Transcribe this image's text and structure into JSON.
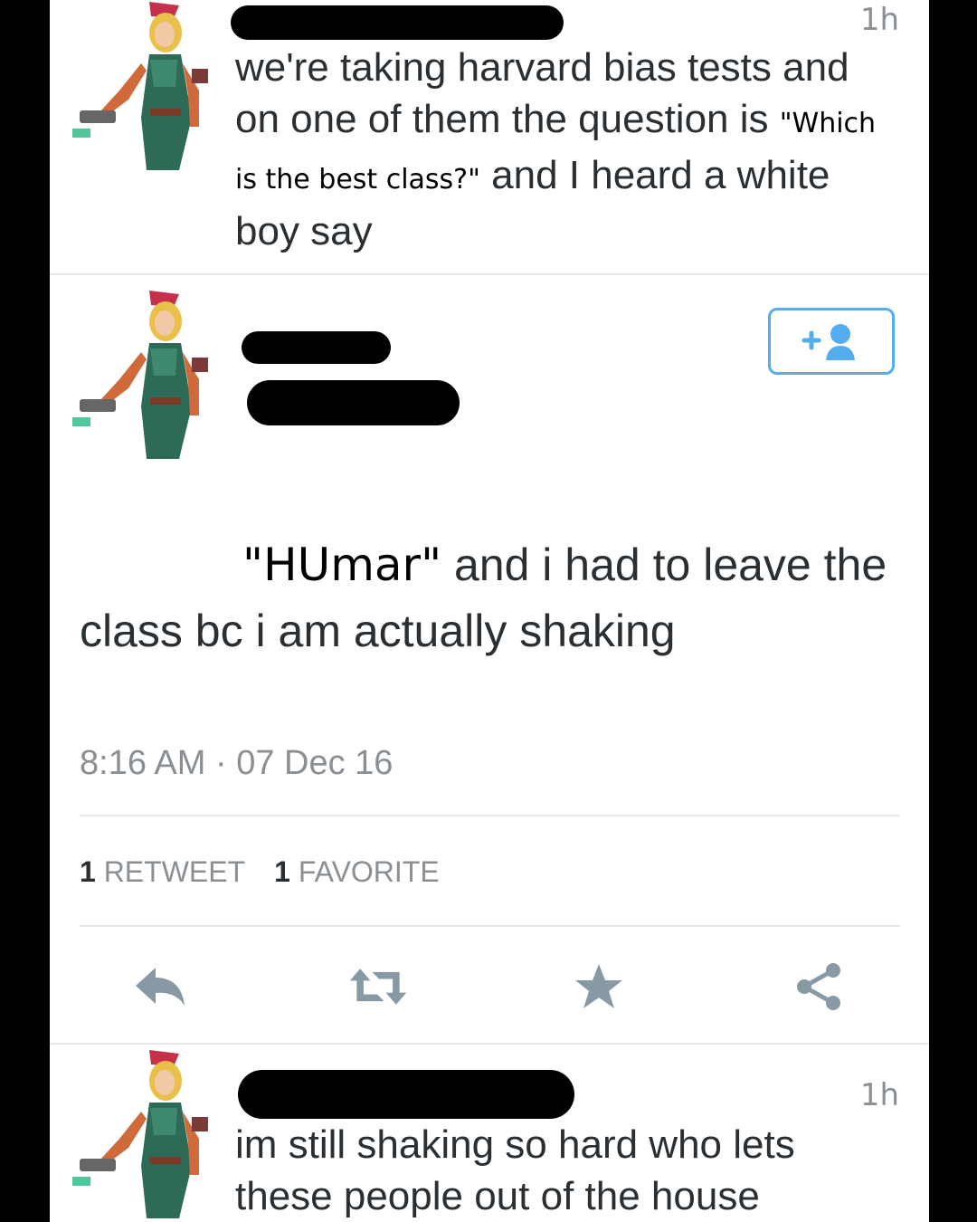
{
  "tweet1": {
    "time": "1h",
    "text_before": "we're taking harvard bias tests and on one of them the question is ",
    "inserted_quote": "\"Which is the best class?\"",
    "text_after": " and I heard a white boy say"
  },
  "main_tweet": {
    "quote": "\"HUmar\"",
    "text": " and i had to leave the class bc i am actually shaking",
    "timestamp": "8:16 AM · 07 Dec 16",
    "retweets_count": "1",
    "retweets_label": "RETWEET",
    "favorites_count": "1",
    "favorites_label": "FAVORITE",
    "actions": [
      "reply-icon",
      "retweet-icon",
      "favorite-star-icon",
      "share-icon"
    ]
  },
  "tweet2": {
    "time": "1h",
    "text": "im still shaking so hard who lets these people out of the house"
  },
  "colors": {
    "accent": "#55acee",
    "text": "#292f33",
    "muted": "#8a8f94",
    "icon": "#8899a6"
  }
}
